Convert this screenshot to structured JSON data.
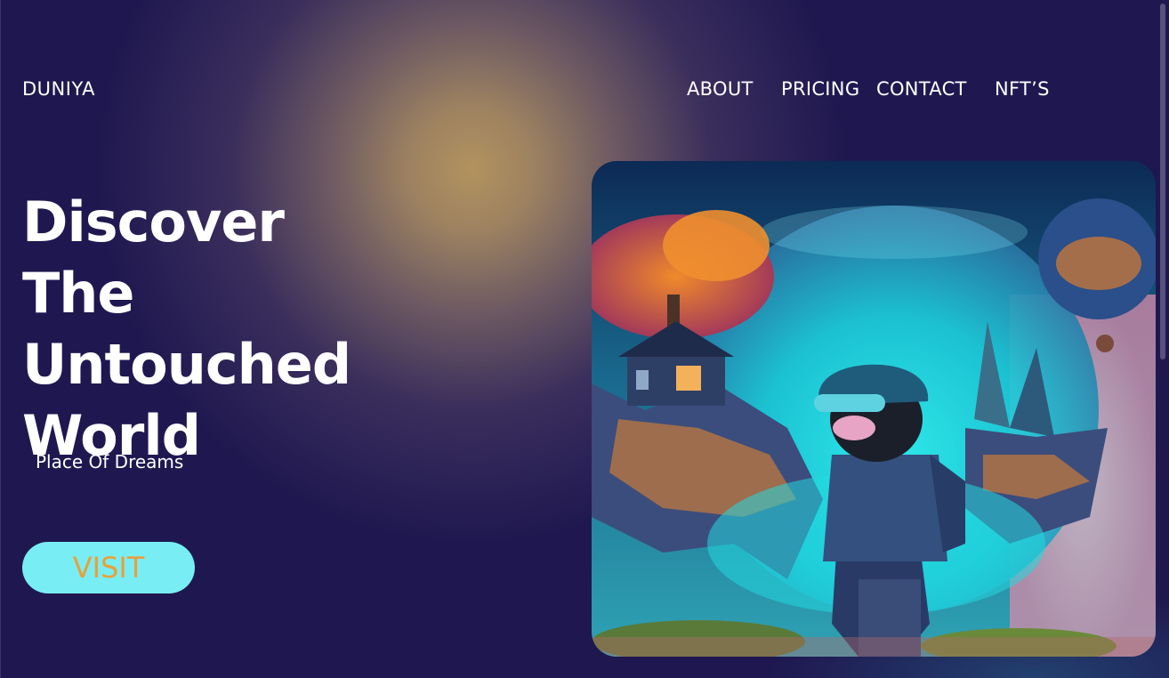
{
  "header": {
    "brand": "DUNIYA",
    "nav": [
      {
        "label": "ABOUT"
      },
      {
        "label": "PRICING"
      },
      {
        "label": "CONTACT"
      },
      {
        "label": "NFT’S"
      }
    ]
  },
  "hero": {
    "title_lines": [
      "Discover The",
      "Untouched",
      "World"
    ],
    "subtitle": "Place Of Dreams",
    "cta_label": "VISIT"
  },
  "colors": {
    "background": "#1f1850",
    "glow": "#b2925e",
    "button_bg": "#78eef4",
    "button_text": "#e9a03a"
  }
}
